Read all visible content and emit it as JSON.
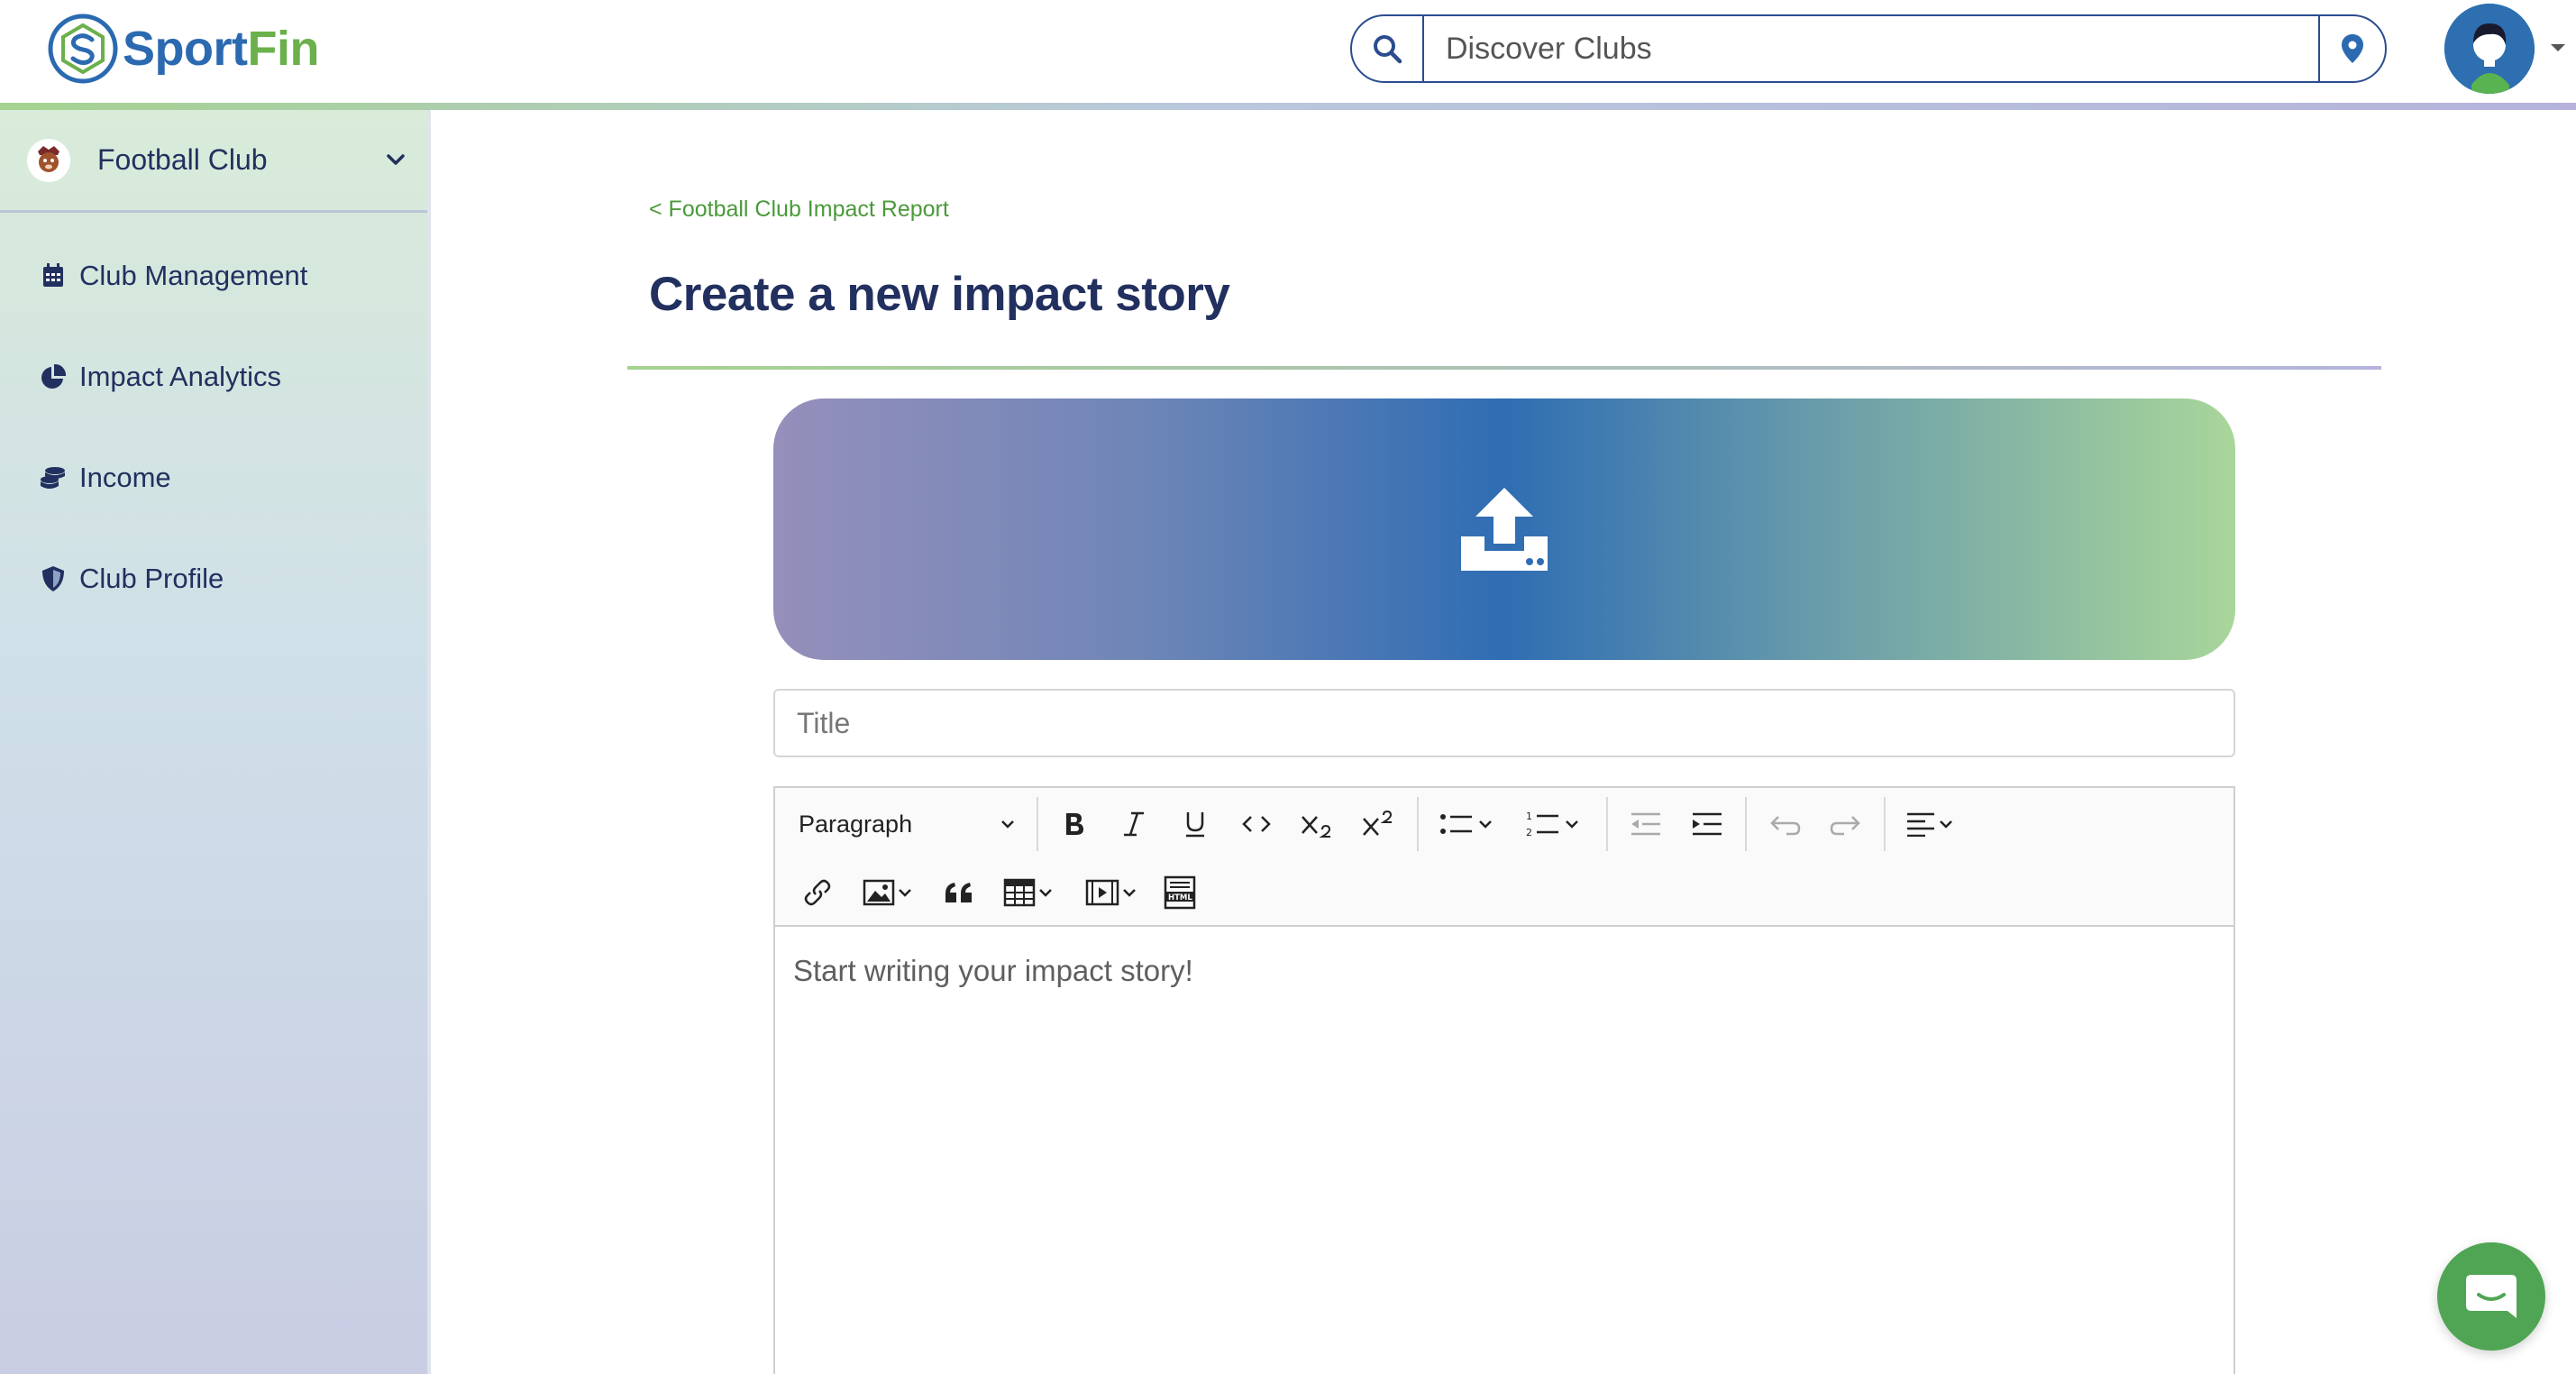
{
  "brand": {
    "name_part1": "Sport",
    "name_part2": "Fin"
  },
  "header": {
    "search": {
      "placeholder": "Discover Clubs",
      "icon": "search-icon",
      "location_icon": "map-pin-icon"
    },
    "avatar": {
      "icon": "user-avatar"
    }
  },
  "sidebar": {
    "club": {
      "name": "Football Club",
      "icon": "club-badge"
    },
    "items": [
      {
        "label": "Club Management",
        "icon": "calendar-icon"
      },
      {
        "label": "Impact Analytics",
        "icon": "pie-chart-icon"
      },
      {
        "label": "Income",
        "icon": "coins-icon"
      },
      {
        "label": "Club Profile",
        "icon": "shield-icon"
      }
    ]
  },
  "main": {
    "breadcrumb": "< Football Club Impact Report",
    "title": "Create a new impact story",
    "upload": {
      "icon": "upload-icon"
    },
    "title_input": {
      "placeholder": "Title"
    },
    "editor": {
      "paragraph_select": "Paragraph",
      "placeholder": "Start writing your impact story!"
    }
  },
  "colors": {
    "primary_navy": "#22305f",
    "brand_blue": "#2b6ab0",
    "brand_green": "#6ab04c",
    "chat_green": "#4fa553"
  }
}
